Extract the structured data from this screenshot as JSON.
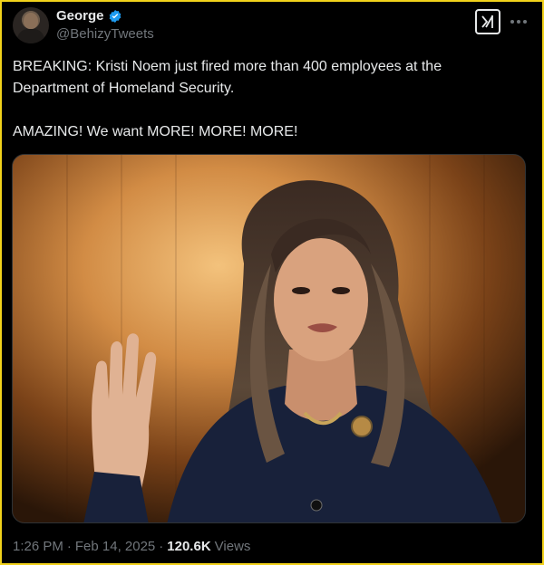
{
  "author": {
    "name": "George",
    "handle": "@BehizyTweets",
    "verified": true,
    "avatar": "avatar"
  },
  "actions": {
    "grok_icon": "grok-icon",
    "more_icon": "more-options-icon"
  },
  "tweet": {
    "text": "BREAKING: Kristi Noem just fired more than 400 employees at the\nDepartment of Homeland Security.\n\nAMAZING! We want MORE! MORE! MORE!"
  },
  "media": {
    "type": "photo",
    "description_icon": "photo"
  },
  "meta": {
    "time": "1:26 PM",
    "separator": "·",
    "date": "Feb 14, 2025",
    "views_count": "120.6K",
    "views_label": "Views"
  },
  "colors": {
    "background": "#000000",
    "text": "#e7e9ea",
    "muted": "#71767b",
    "verified": "#1d9bf0",
    "frame_border": "#f2d21b"
  }
}
